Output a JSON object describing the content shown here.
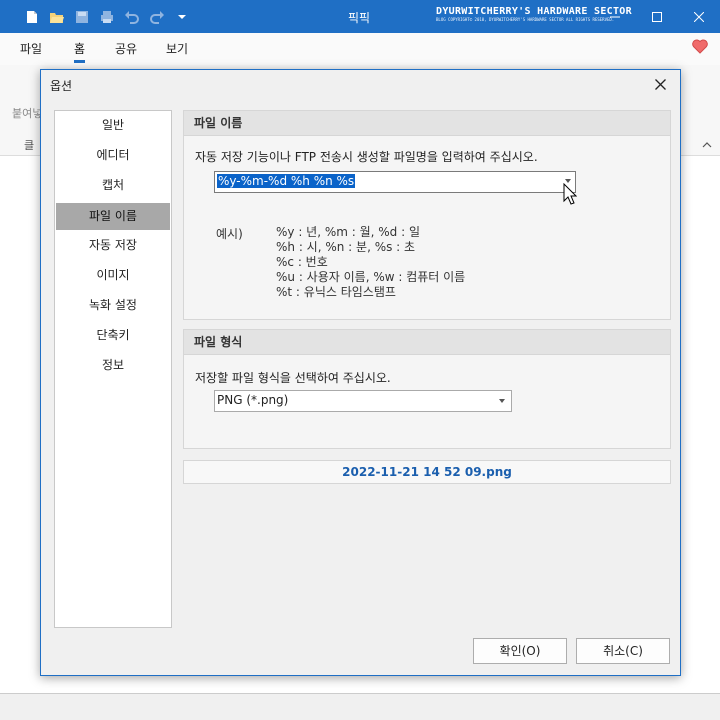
{
  "app": {
    "title": "픽픽",
    "brand_line1": "DYURWITCHERRY'S HARDWARE SECTOR",
    "brand_line2": "BLOG COPYRIGHT© 2010, DYURWITCHERRY'S HARDWARE SECTOR ALL RIGHTS RESERVED."
  },
  "menu": {
    "tabs": [
      "파일",
      "홈",
      "공유",
      "보기"
    ],
    "active_index": 1
  },
  "ribbon": {
    "paste_label": "붙여넣",
    "clipboard_label": "클"
  },
  "dialog": {
    "title": "옵션",
    "nav": [
      "일반",
      "에디터",
      "캡처",
      "파일 이름",
      "자동 저장",
      "이미지",
      "녹화 설정",
      "단축키",
      "정보"
    ],
    "selected_nav": 3,
    "filename_section": {
      "header": "파일 이름",
      "description": "자동 저장 기능이나 FTP 전송시 생성할 파일명을 입력하여 주십시오.",
      "pattern_value": "%y-%m-%d %h %n %s",
      "example_label": "예시)",
      "example_lines": [
        "%y : 년, %m : 월, %d : 일",
        "%h : 시, %n : 분, %s : 초",
        "%c : 번호",
        "%u : 사용자 이름, %w : 컴퓨터 이름",
        "%t : 유닉스 타임스탬프"
      ]
    },
    "format_section": {
      "header": "파일 형식",
      "description": "저장할 파일 형식을 선택하여 주십시오.",
      "format_value": "PNG (*.png)"
    },
    "preview_filename": "2022-11-21 14 52 09.png",
    "ok_label": "확인(O)",
    "cancel_label": "취소(C)"
  },
  "colors": {
    "accent": "#1f6fc5",
    "preview_text": "#1b5fae",
    "selection": "#0a63c9"
  }
}
